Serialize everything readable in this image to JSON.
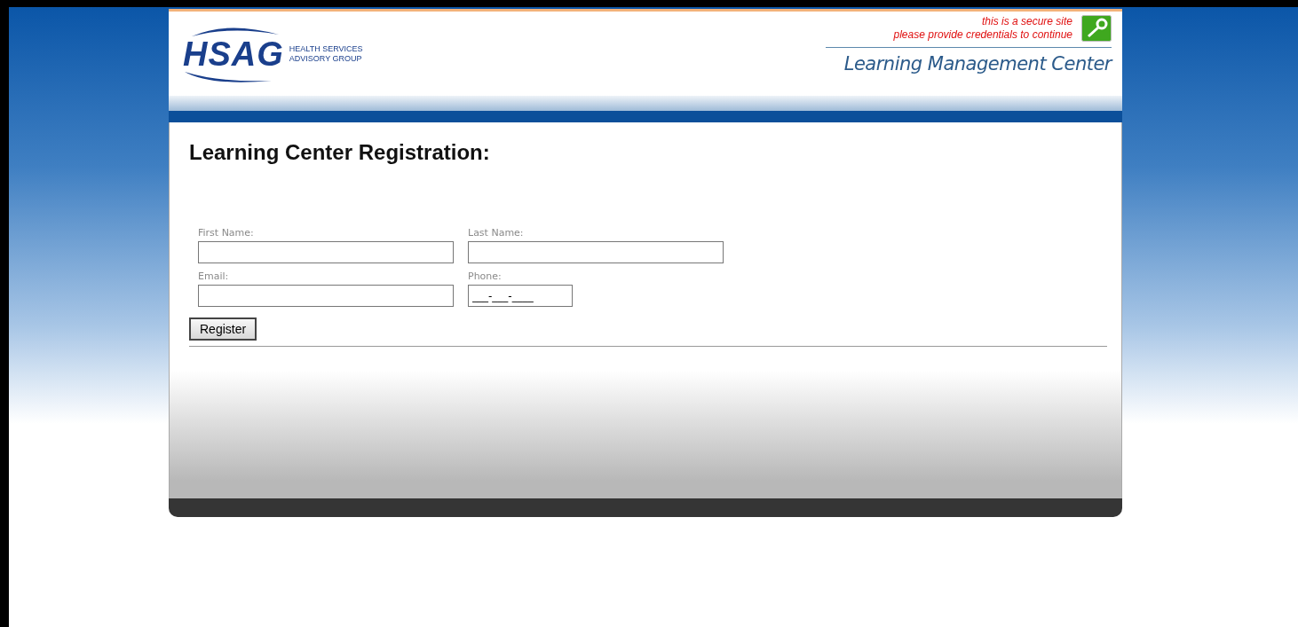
{
  "header": {
    "logo_text": "HSAG",
    "logo_subtitle": [
      "HEALTH SERVICES",
      "ADVISORY GROUP"
    ],
    "secure_notice": [
      "this is a secure site",
      "please provide credentials to continue"
    ],
    "site_title": "Learning Management Center"
  },
  "page_title": "Learning Center Registration:",
  "fields": [
    {
      "label": "First Name:",
      "kind": "text"
    },
    {
      "label": "Last Name:",
      "kind": "text"
    },
    {
      "label": "Email:",
      "kind": "text"
    },
    {
      "label": "Phone:",
      "value": "___-___-____",
      "kind": "phone"
    }
  ],
  "buttons": [
    "Register"
  ]
}
